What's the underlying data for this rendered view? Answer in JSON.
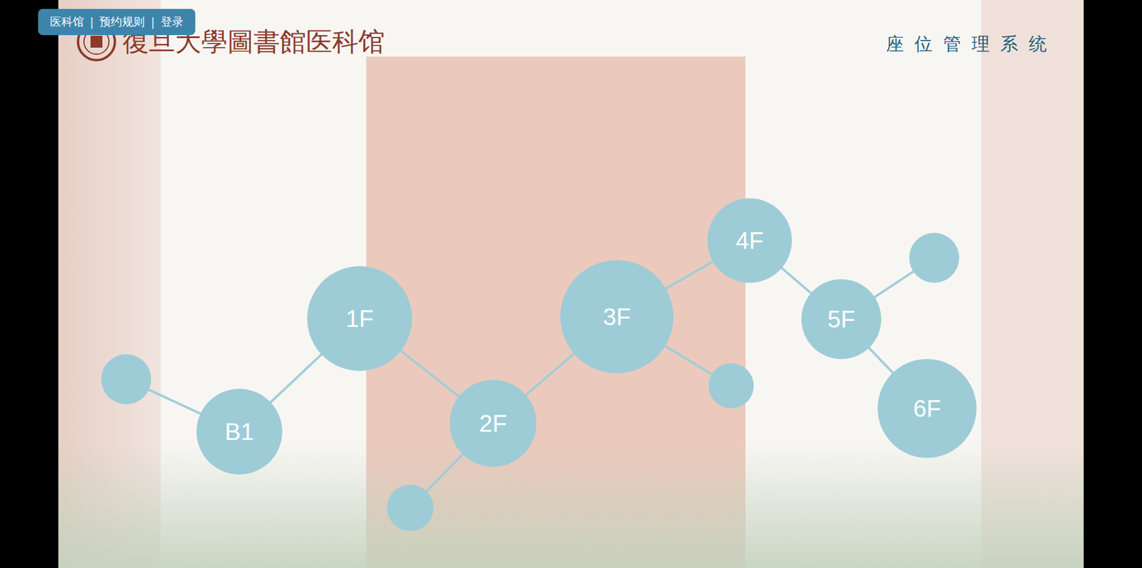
{
  "nav": {
    "items": [
      {
        "label": "医科馆"
      },
      {
        "label": "预约规则"
      },
      {
        "label": "登录"
      }
    ],
    "separator": "|"
  },
  "header": {
    "logo": "復旦大學圖書館医科馆",
    "system_title": "座位管理系统"
  },
  "floors": [
    {
      "label": "B1"
    },
    {
      "label": "1F"
    },
    {
      "label": "2F"
    },
    {
      "label": "3F"
    },
    {
      "label": "4F"
    },
    {
      "label": "5F"
    },
    {
      "label": "6F"
    }
  ]
}
